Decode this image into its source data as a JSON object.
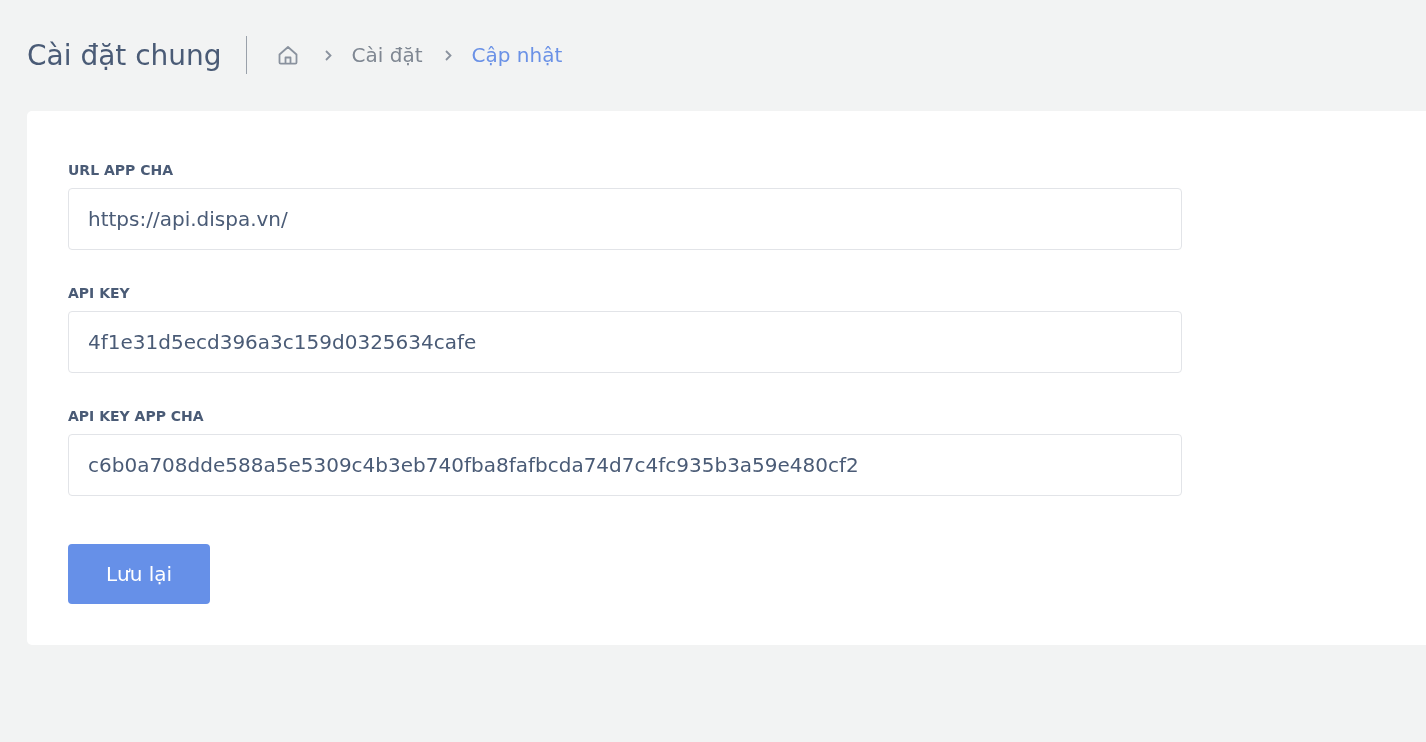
{
  "header": {
    "title": "Cài đặt chung",
    "breadcrumb": [
      {
        "label": "Cài đặt",
        "current": false
      },
      {
        "label": "Cập nhật",
        "current": true
      }
    ]
  },
  "form": {
    "fields": [
      {
        "label": "URL APP CHA",
        "value": "https://api.dispa.vn/"
      },
      {
        "label": "API KEY",
        "value": "4f1e31d5ecd396a3c159d0325634cafe"
      },
      {
        "label": "API KEY APP CHA",
        "value": "c6b0a708dde588a5e5309c4b3eb740fba8fafbcda74d7c4fc935b3a59e480cf2"
      }
    ],
    "submit_button": "Lưu lại"
  }
}
